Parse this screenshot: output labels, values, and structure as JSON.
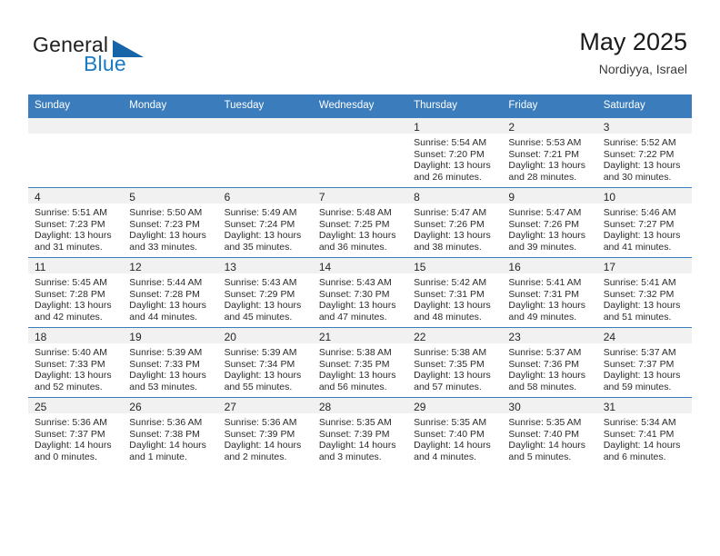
{
  "brand": {
    "word_one": "General",
    "word_two": "Blue",
    "triangle_icon": "brand-triangle-icon",
    "accent_color": "#1b7ac4",
    "triangle_color": "#1565a8"
  },
  "header": {
    "month_title": "May 2025",
    "location": "Nordiyya, Israel"
  },
  "theme": {
    "header_blue": "#3a7cbc",
    "row_rule_blue": "#2e6da4",
    "daynum_band": "#f1f1f1"
  },
  "weekday_headers": [
    "Sunday",
    "Monday",
    "Tuesday",
    "Wednesday",
    "Thursday",
    "Friday",
    "Saturday"
  ],
  "labels": {
    "sunrise_prefix": "Sunrise:",
    "sunset_prefix": "Sunset:",
    "daylight_prefix": "Daylight:"
  },
  "weeks": [
    [
      {
        "day": "",
        "empty": true
      },
      {
        "day": "",
        "empty": true
      },
      {
        "day": "",
        "empty": true
      },
      {
        "day": "",
        "empty": true
      },
      {
        "day": "1",
        "sunrise": "Sunrise: 5:54 AM",
        "sunset": "Sunset: 7:20 PM",
        "daylight": "Daylight: 13 hours and 26 minutes."
      },
      {
        "day": "2",
        "sunrise": "Sunrise: 5:53 AM",
        "sunset": "Sunset: 7:21 PM",
        "daylight": "Daylight: 13 hours and 28 minutes."
      },
      {
        "day": "3",
        "sunrise": "Sunrise: 5:52 AM",
        "sunset": "Sunset: 7:22 PM",
        "daylight": "Daylight: 13 hours and 30 minutes."
      }
    ],
    [
      {
        "day": "4",
        "sunrise": "Sunrise: 5:51 AM",
        "sunset": "Sunset: 7:23 PM",
        "daylight": "Daylight: 13 hours and 31 minutes."
      },
      {
        "day": "5",
        "sunrise": "Sunrise: 5:50 AM",
        "sunset": "Sunset: 7:23 PM",
        "daylight": "Daylight: 13 hours and 33 minutes."
      },
      {
        "day": "6",
        "sunrise": "Sunrise: 5:49 AM",
        "sunset": "Sunset: 7:24 PM",
        "daylight": "Daylight: 13 hours and 35 minutes."
      },
      {
        "day": "7",
        "sunrise": "Sunrise: 5:48 AM",
        "sunset": "Sunset: 7:25 PM",
        "daylight": "Daylight: 13 hours and 36 minutes."
      },
      {
        "day": "8",
        "sunrise": "Sunrise: 5:47 AM",
        "sunset": "Sunset: 7:26 PM",
        "daylight": "Daylight: 13 hours and 38 minutes."
      },
      {
        "day": "9",
        "sunrise": "Sunrise: 5:47 AM",
        "sunset": "Sunset: 7:26 PM",
        "daylight": "Daylight: 13 hours and 39 minutes."
      },
      {
        "day": "10",
        "sunrise": "Sunrise: 5:46 AM",
        "sunset": "Sunset: 7:27 PM",
        "daylight": "Daylight: 13 hours and 41 minutes."
      }
    ],
    [
      {
        "day": "11",
        "sunrise": "Sunrise: 5:45 AM",
        "sunset": "Sunset: 7:28 PM",
        "daylight": "Daylight: 13 hours and 42 minutes."
      },
      {
        "day": "12",
        "sunrise": "Sunrise: 5:44 AM",
        "sunset": "Sunset: 7:28 PM",
        "daylight": "Daylight: 13 hours and 44 minutes."
      },
      {
        "day": "13",
        "sunrise": "Sunrise: 5:43 AM",
        "sunset": "Sunset: 7:29 PM",
        "daylight": "Daylight: 13 hours and 45 minutes."
      },
      {
        "day": "14",
        "sunrise": "Sunrise: 5:43 AM",
        "sunset": "Sunset: 7:30 PM",
        "daylight": "Daylight: 13 hours and 47 minutes."
      },
      {
        "day": "15",
        "sunrise": "Sunrise: 5:42 AM",
        "sunset": "Sunset: 7:31 PM",
        "daylight": "Daylight: 13 hours and 48 minutes."
      },
      {
        "day": "16",
        "sunrise": "Sunrise: 5:41 AM",
        "sunset": "Sunset: 7:31 PM",
        "daylight": "Daylight: 13 hours and 49 minutes."
      },
      {
        "day": "17",
        "sunrise": "Sunrise: 5:41 AM",
        "sunset": "Sunset: 7:32 PM",
        "daylight": "Daylight: 13 hours and 51 minutes."
      }
    ],
    [
      {
        "day": "18",
        "sunrise": "Sunrise: 5:40 AM",
        "sunset": "Sunset: 7:33 PM",
        "daylight": "Daylight: 13 hours and 52 minutes."
      },
      {
        "day": "19",
        "sunrise": "Sunrise: 5:39 AM",
        "sunset": "Sunset: 7:33 PM",
        "daylight": "Daylight: 13 hours and 53 minutes."
      },
      {
        "day": "20",
        "sunrise": "Sunrise: 5:39 AM",
        "sunset": "Sunset: 7:34 PM",
        "daylight": "Daylight: 13 hours and 55 minutes."
      },
      {
        "day": "21",
        "sunrise": "Sunrise: 5:38 AM",
        "sunset": "Sunset: 7:35 PM",
        "daylight": "Daylight: 13 hours and 56 minutes."
      },
      {
        "day": "22",
        "sunrise": "Sunrise: 5:38 AM",
        "sunset": "Sunset: 7:35 PM",
        "daylight": "Daylight: 13 hours and 57 minutes."
      },
      {
        "day": "23",
        "sunrise": "Sunrise: 5:37 AM",
        "sunset": "Sunset: 7:36 PM",
        "daylight": "Daylight: 13 hours and 58 minutes."
      },
      {
        "day": "24",
        "sunrise": "Sunrise: 5:37 AM",
        "sunset": "Sunset: 7:37 PM",
        "daylight": "Daylight: 13 hours and 59 minutes."
      }
    ],
    [
      {
        "day": "25",
        "sunrise": "Sunrise: 5:36 AM",
        "sunset": "Sunset: 7:37 PM",
        "daylight": "Daylight: 14 hours and 0 minutes."
      },
      {
        "day": "26",
        "sunrise": "Sunrise: 5:36 AM",
        "sunset": "Sunset: 7:38 PM",
        "daylight": "Daylight: 14 hours and 1 minute."
      },
      {
        "day": "27",
        "sunrise": "Sunrise: 5:36 AM",
        "sunset": "Sunset: 7:39 PM",
        "daylight": "Daylight: 14 hours and 2 minutes."
      },
      {
        "day": "28",
        "sunrise": "Sunrise: 5:35 AM",
        "sunset": "Sunset: 7:39 PM",
        "daylight": "Daylight: 14 hours and 3 minutes."
      },
      {
        "day": "29",
        "sunrise": "Sunrise: 5:35 AM",
        "sunset": "Sunset: 7:40 PM",
        "daylight": "Daylight: 14 hours and 4 minutes."
      },
      {
        "day": "30",
        "sunrise": "Sunrise: 5:35 AM",
        "sunset": "Sunset: 7:40 PM",
        "daylight": "Daylight: 14 hours and 5 minutes."
      },
      {
        "day": "31",
        "sunrise": "Sunrise: 5:34 AM",
        "sunset": "Sunset: 7:41 PM",
        "daylight": "Daylight: 14 hours and 6 minutes."
      }
    ]
  ]
}
